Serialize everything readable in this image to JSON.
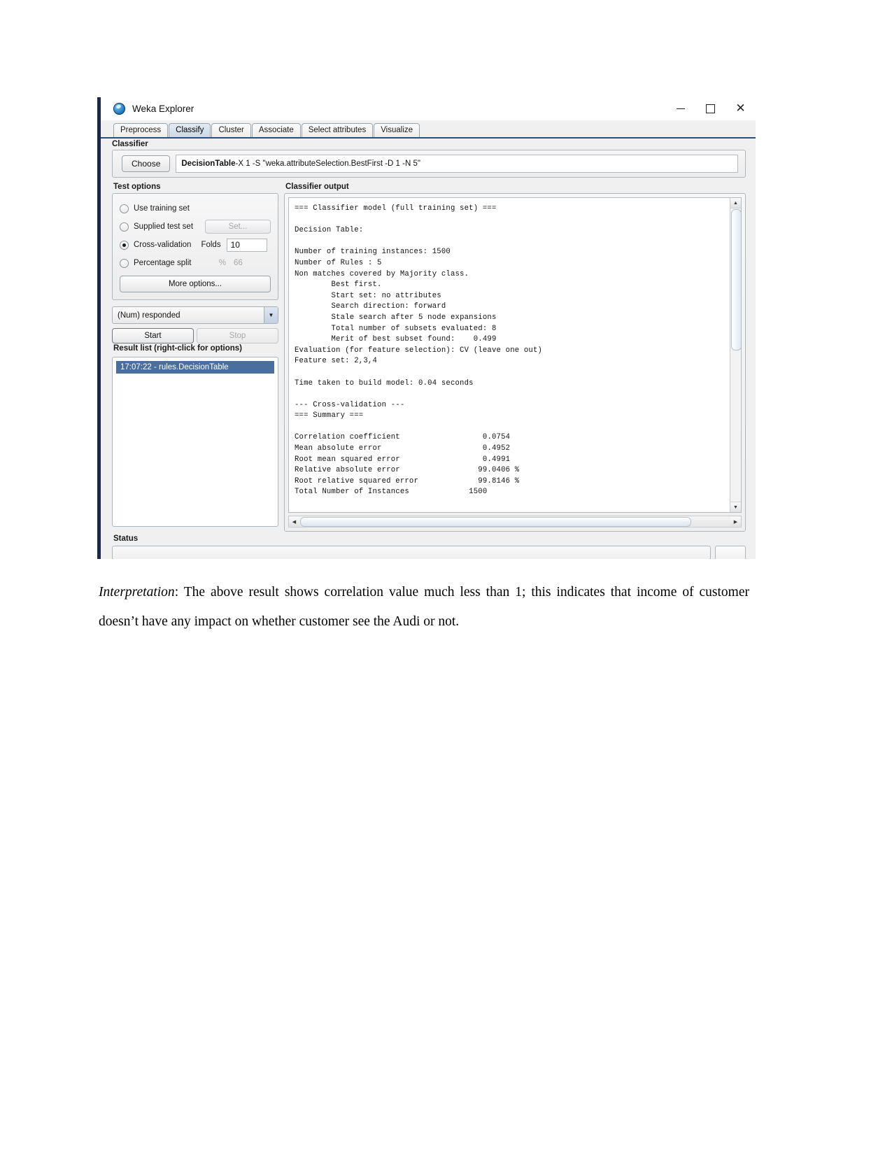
{
  "window": {
    "title": "Weka Explorer",
    "icon": "weka-bird-icon",
    "controls": {
      "minimize": "minimize-icon",
      "maximize": "maximize-icon",
      "close": "close-icon"
    }
  },
  "tabs": [
    {
      "label": "Preprocess",
      "active": false
    },
    {
      "label": "Classify",
      "active": true
    },
    {
      "label": "Cluster",
      "active": false
    },
    {
      "label": "Associate",
      "active": false
    },
    {
      "label": "Select attributes",
      "active": false
    },
    {
      "label": "Visualize",
      "active": false
    }
  ],
  "classifier": {
    "group_label": "Classifier",
    "choose_label": "Choose",
    "scheme_name": "DecisionTable",
    "scheme_options": " -X 1 -S \"weka.attributeSelection.BestFirst -D 1 -N 5\""
  },
  "test_options": {
    "group_label": "Test options",
    "options": [
      {
        "label": "Use training set",
        "selected": false
      },
      {
        "label": "Supplied test set",
        "selected": false
      },
      {
        "label": "Cross-validation",
        "selected": true
      },
      {
        "label": "Percentage split",
        "selected": false
      }
    ],
    "set_button": "Set...",
    "folds_label": "Folds",
    "folds_value": "10",
    "percent_label": "%",
    "percent_value": "66",
    "more_options": "More options..."
  },
  "class_combo": {
    "selected": "(Num) responded",
    "arrow": "chevron-down-icon"
  },
  "actions": {
    "start": "Start",
    "stop": "Stop"
  },
  "result_list": {
    "label": "Result list (right-click for options)",
    "items": [
      {
        "label": "17:07:22 - rules.DecisionTable",
        "selected": true
      }
    ]
  },
  "classifier_output": {
    "label": "Classifier output",
    "text": "=== Classifier model (full training set) ===\n\nDecision Table:\n\nNumber of training instances: 1500\nNumber of Rules : 5\nNon matches covered by Majority class.\n\tBest first.\n\tStart set: no attributes\n\tSearch direction: forward\n\tStale search after 5 node expansions\n\tTotal number of subsets evaluated: 8\n\tMerit of best subset found:    0.499\nEvaluation (for feature selection): CV (leave one out)\nFeature set: 2,3,4\n\nTime taken to build model: 0.04 seconds\n\n--- Cross-validation ---\n=== Summary ===\n\nCorrelation coefficient                  0.0754\nMean absolute error                      0.4952\nRoot mean squared error                  0.4991\nRelative absolute error                 99.0406 %\nRoot relative squared error             99.8146 %\nTotal Number of Instances             1500     "
  },
  "metrics": {
    "number_of_training_instances": "1500",
    "number_of_rules": "5",
    "total_subsets_evaluated": "8",
    "merit_of_best_subset": "0.499",
    "feature_set": "2,3,4",
    "time_taken_seconds": "0.04",
    "correlation_coefficient": "0.0754",
    "mean_absolute_error": "0.4952",
    "root_mean_squared_error": "0.4991",
    "relative_absolute_error": "99.0406 %",
    "root_relative_squared_error": "99.8146 %",
    "total_number_of_instances": "1500"
  },
  "status": {
    "label": "Status",
    "text": ""
  },
  "document": {
    "interpretation_lead": "Interpretation",
    "interpretation_body": ": The above result shows correlation value much less than 1; this indicates that income of customer doesn’t have any impact on whether customer see the Audi or not."
  }
}
